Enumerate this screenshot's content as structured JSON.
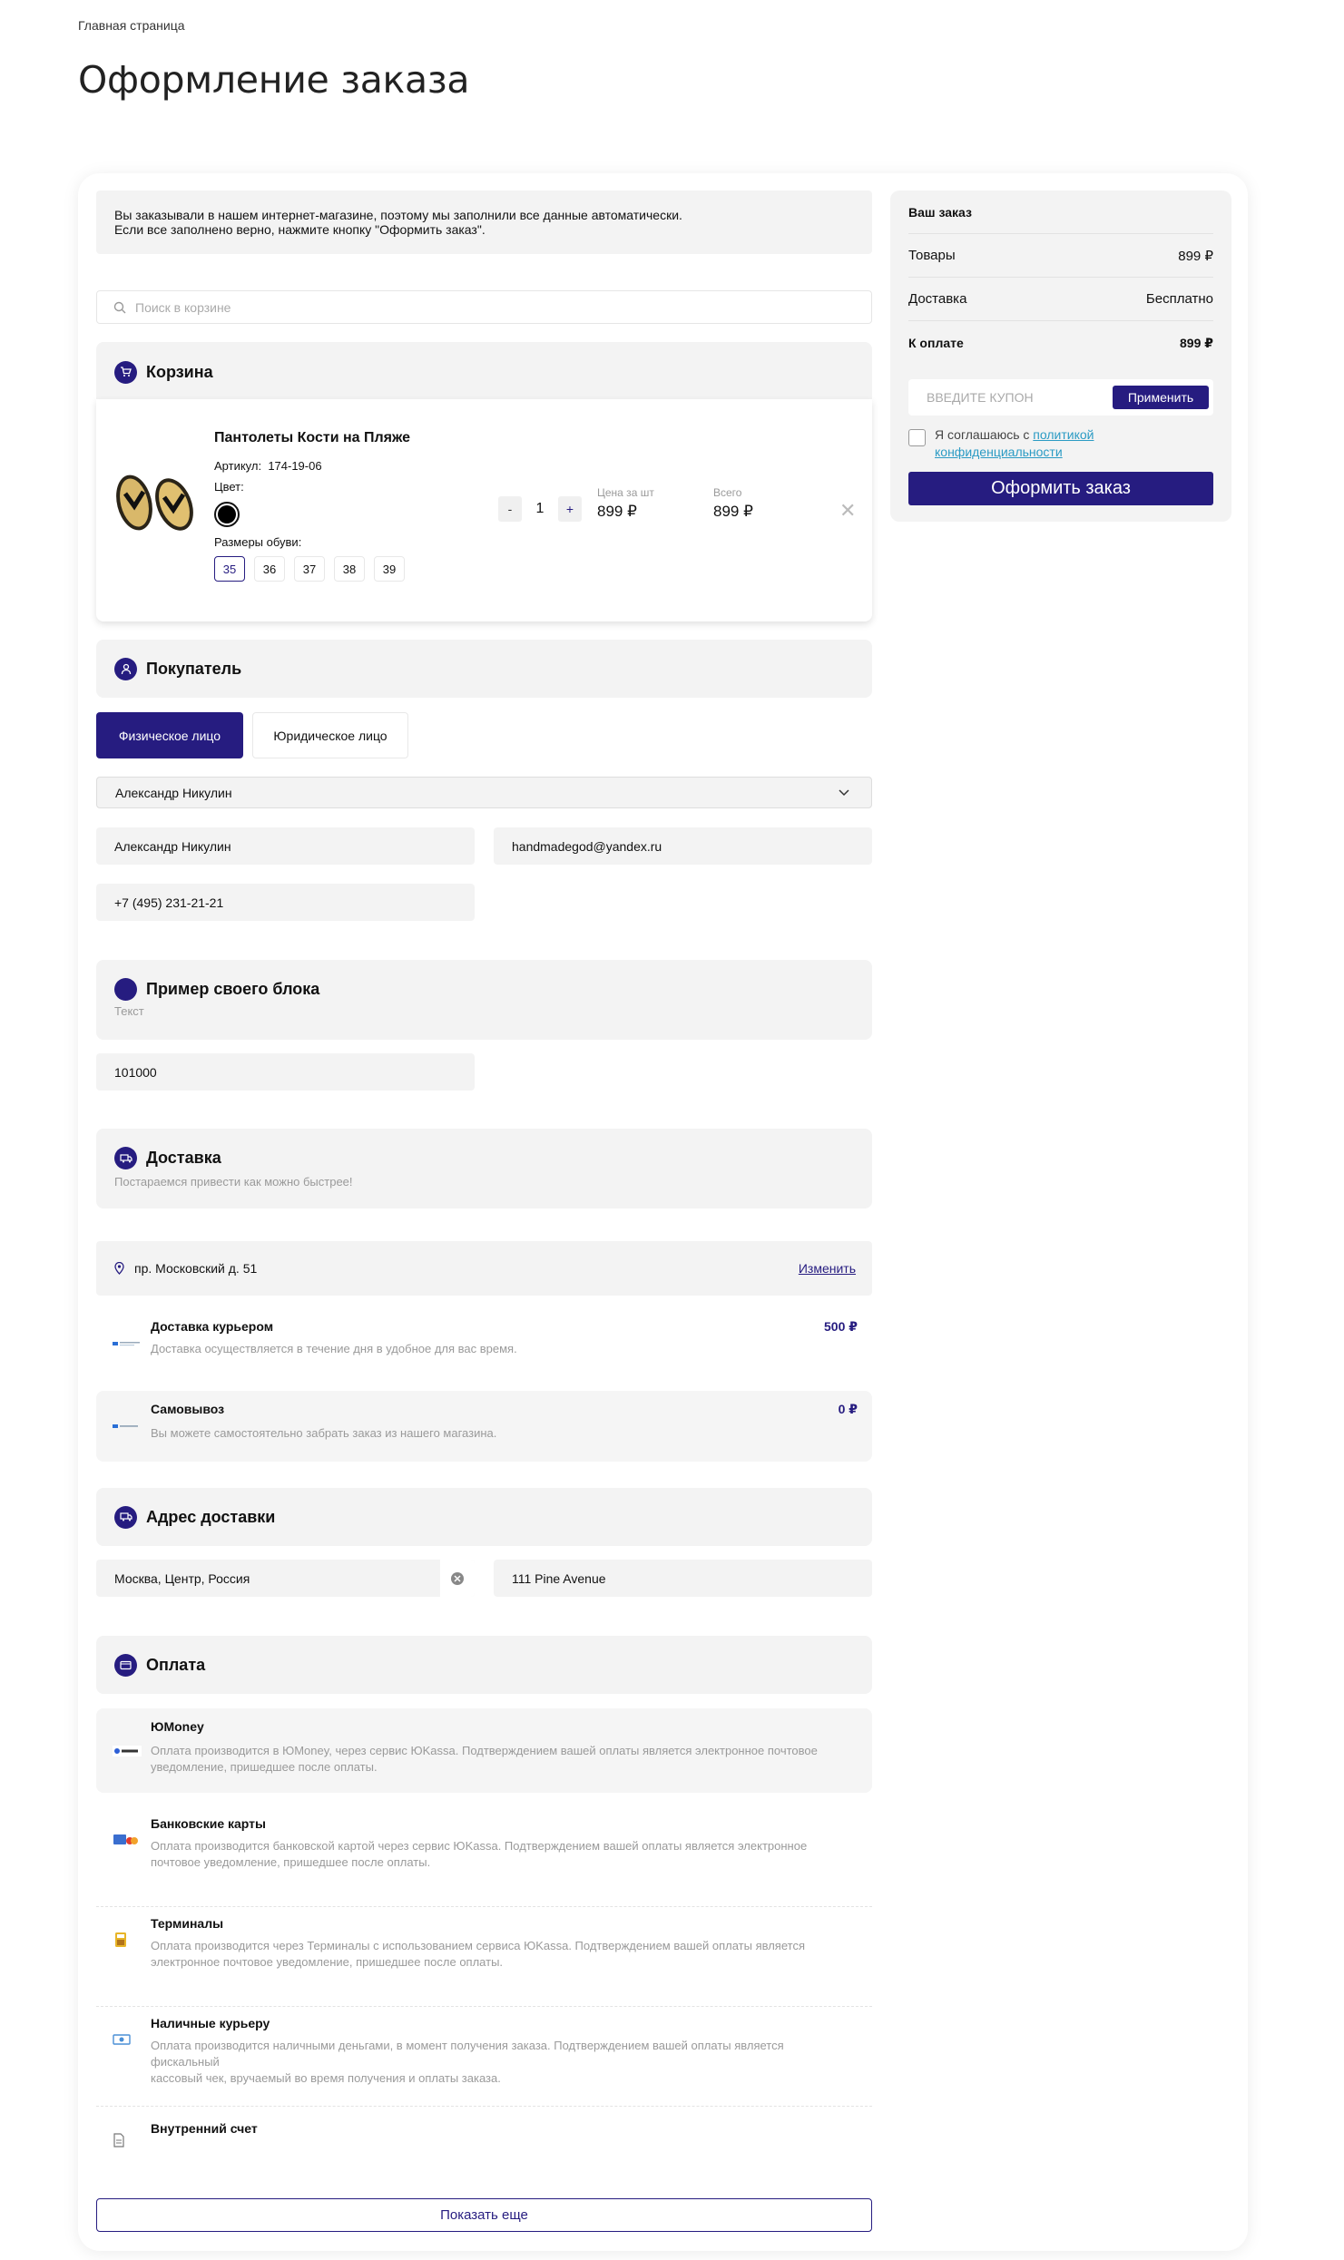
{
  "breadcrumb": "Главная страница",
  "page_title": "Оформление заказа",
  "notice": {
    "line1": "Вы заказывали в нашем интернет-магазине, поэтому мы заполнили все данные автоматически.",
    "line2": "Если все заполнено верно, нажмите кнопку \"Оформить заказ\"."
  },
  "search": {
    "placeholder": "Поиск в корзине",
    "icon": "search-icon"
  },
  "cart": {
    "title": "Корзина",
    "icon": "cart-icon",
    "item": {
      "name": "Пантолеты Кости на Пляже",
      "article_label": "Артикул:",
      "article": "174-19-06",
      "color_label": "Цвет:",
      "color": "#000000",
      "sizes_label": "Размеры обуви:",
      "sizes": [
        "35",
        "36",
        "37",
        "38",
        "39"
      ],
      "selected_size": "35",
      "qty_minus": "-",
      "qty": "1",
      "qty_plus": "+",
      "unit_price_label": "Цена за шт",
      "unit_price": "899 ₽",
      "total_label": "Всего",
      "total": "899 ₽",
      "remove": "✕"
    }
  },
  "buyer": {
    "title": "Покупатель",
    "icon": "user-icon",
    "tabs": [
      "Физическое лицо",
      "Юридическое лицо"
    ],
    "profile_select": "Александр Никулин",
    "name": "Александр Никулин",
    "email": "handmadegod@yandex.ru",
    "phone": "+7 (495) 231-21-21"
  },
  "custom_block": {
    "title": "Пример своего блока",
    "subtitle": "Текст",
    "value": "101000"
  },
  "delivery": {
    "title": "Доставка",
    "icon": "truck-icon",
    "subtitle": "Постараемся привести как можно быстрее!",
    "address": "пр. Московский д. 51",
    "change": "Изменить",
    "options": [
      {
        "title": "Доставка курьером",
        "desc": "Доставка осуществляется в течение дня в удобное для вас время.",
        "price": "500 ₽"
      },
      {
        "title": "Самовывоз",
        "desc": "Вы можете самостоятельно забрать заказ из нашего магазина.",
        "price": "0 ₽"
      }
    ]
  },
  "delivery_address": {
    "title": "Адрес доставки",
    "icon": "truck-icon",
    "location": "Москва, Центр, Россия",
    "street": "111 Pine Avenue"
  },
  "payment": {
    "title": "Оплата",
    "icon": "wallet-icon",
    "options": [
      {
        "title": "ЮMoney",
        "desc1": "Оплата производится в ЮMoney, через сервис ЮKassa. Подтверждением вашей оплаты является электронное почтовое",
        "desc2": "уведомление, пришедшее после оплаты."
      },
      {
        "title": "Банковские карты",
        "desc1": "Оплата производится банковской картой через сервис ЮKassa. Подтверждением вашей оплаты является электронное",
        "desc2": "почтовое уведомление, пришедшее после оплаты."
      },
      {
        "title": "Терминалы",
        "desc1": "Оплата производится через Терминалы с использованием сервиса ЮKassa. Подтверждением вашей оплаты является",
        "desc2": "электронное почтовое уведомление, пришедшее после оплаты."
      },
      {
        "title": "Наличные курьеру",
        "desc1": "Оплата производится наличными деньгами, в момент получения заказа. Подтверждением вашей оплаты является фискальный",
        "desc2": "кассовый чек, вручаемый во время получения и оплаты заказа."
      },
      {
        "title": "Внутренний счет",
        "desc1": "",
        "desc2": ""
      }
    ],
    "show_more": "Показать еще"
  },
  "summary": {
    "title": "Ваш заказ",
    "goods_label": "Товары",
    "goods_value": "899 ₽",
    "delivery_label": "Доставка",
    "delivery_value": "Бесплатно",
    "total_label": "К оплате",
    "total_value": "899 ₽",
    "coupon_placeholder": "ВВЕДИТЕ КУПОН",
    "apply": "Применить",
    "agree_prefix": "Я соглашаюсь с ",
    "agree_link1": "политикой",
    "agree_link2": "конфиденциальности",
    "submit": "Оформить заказ"
  },
  "colors": {
    "accent": "#261c80",
    "panel": "#f3f3f3",
    "link": "#2b9bc4"
  }
}
